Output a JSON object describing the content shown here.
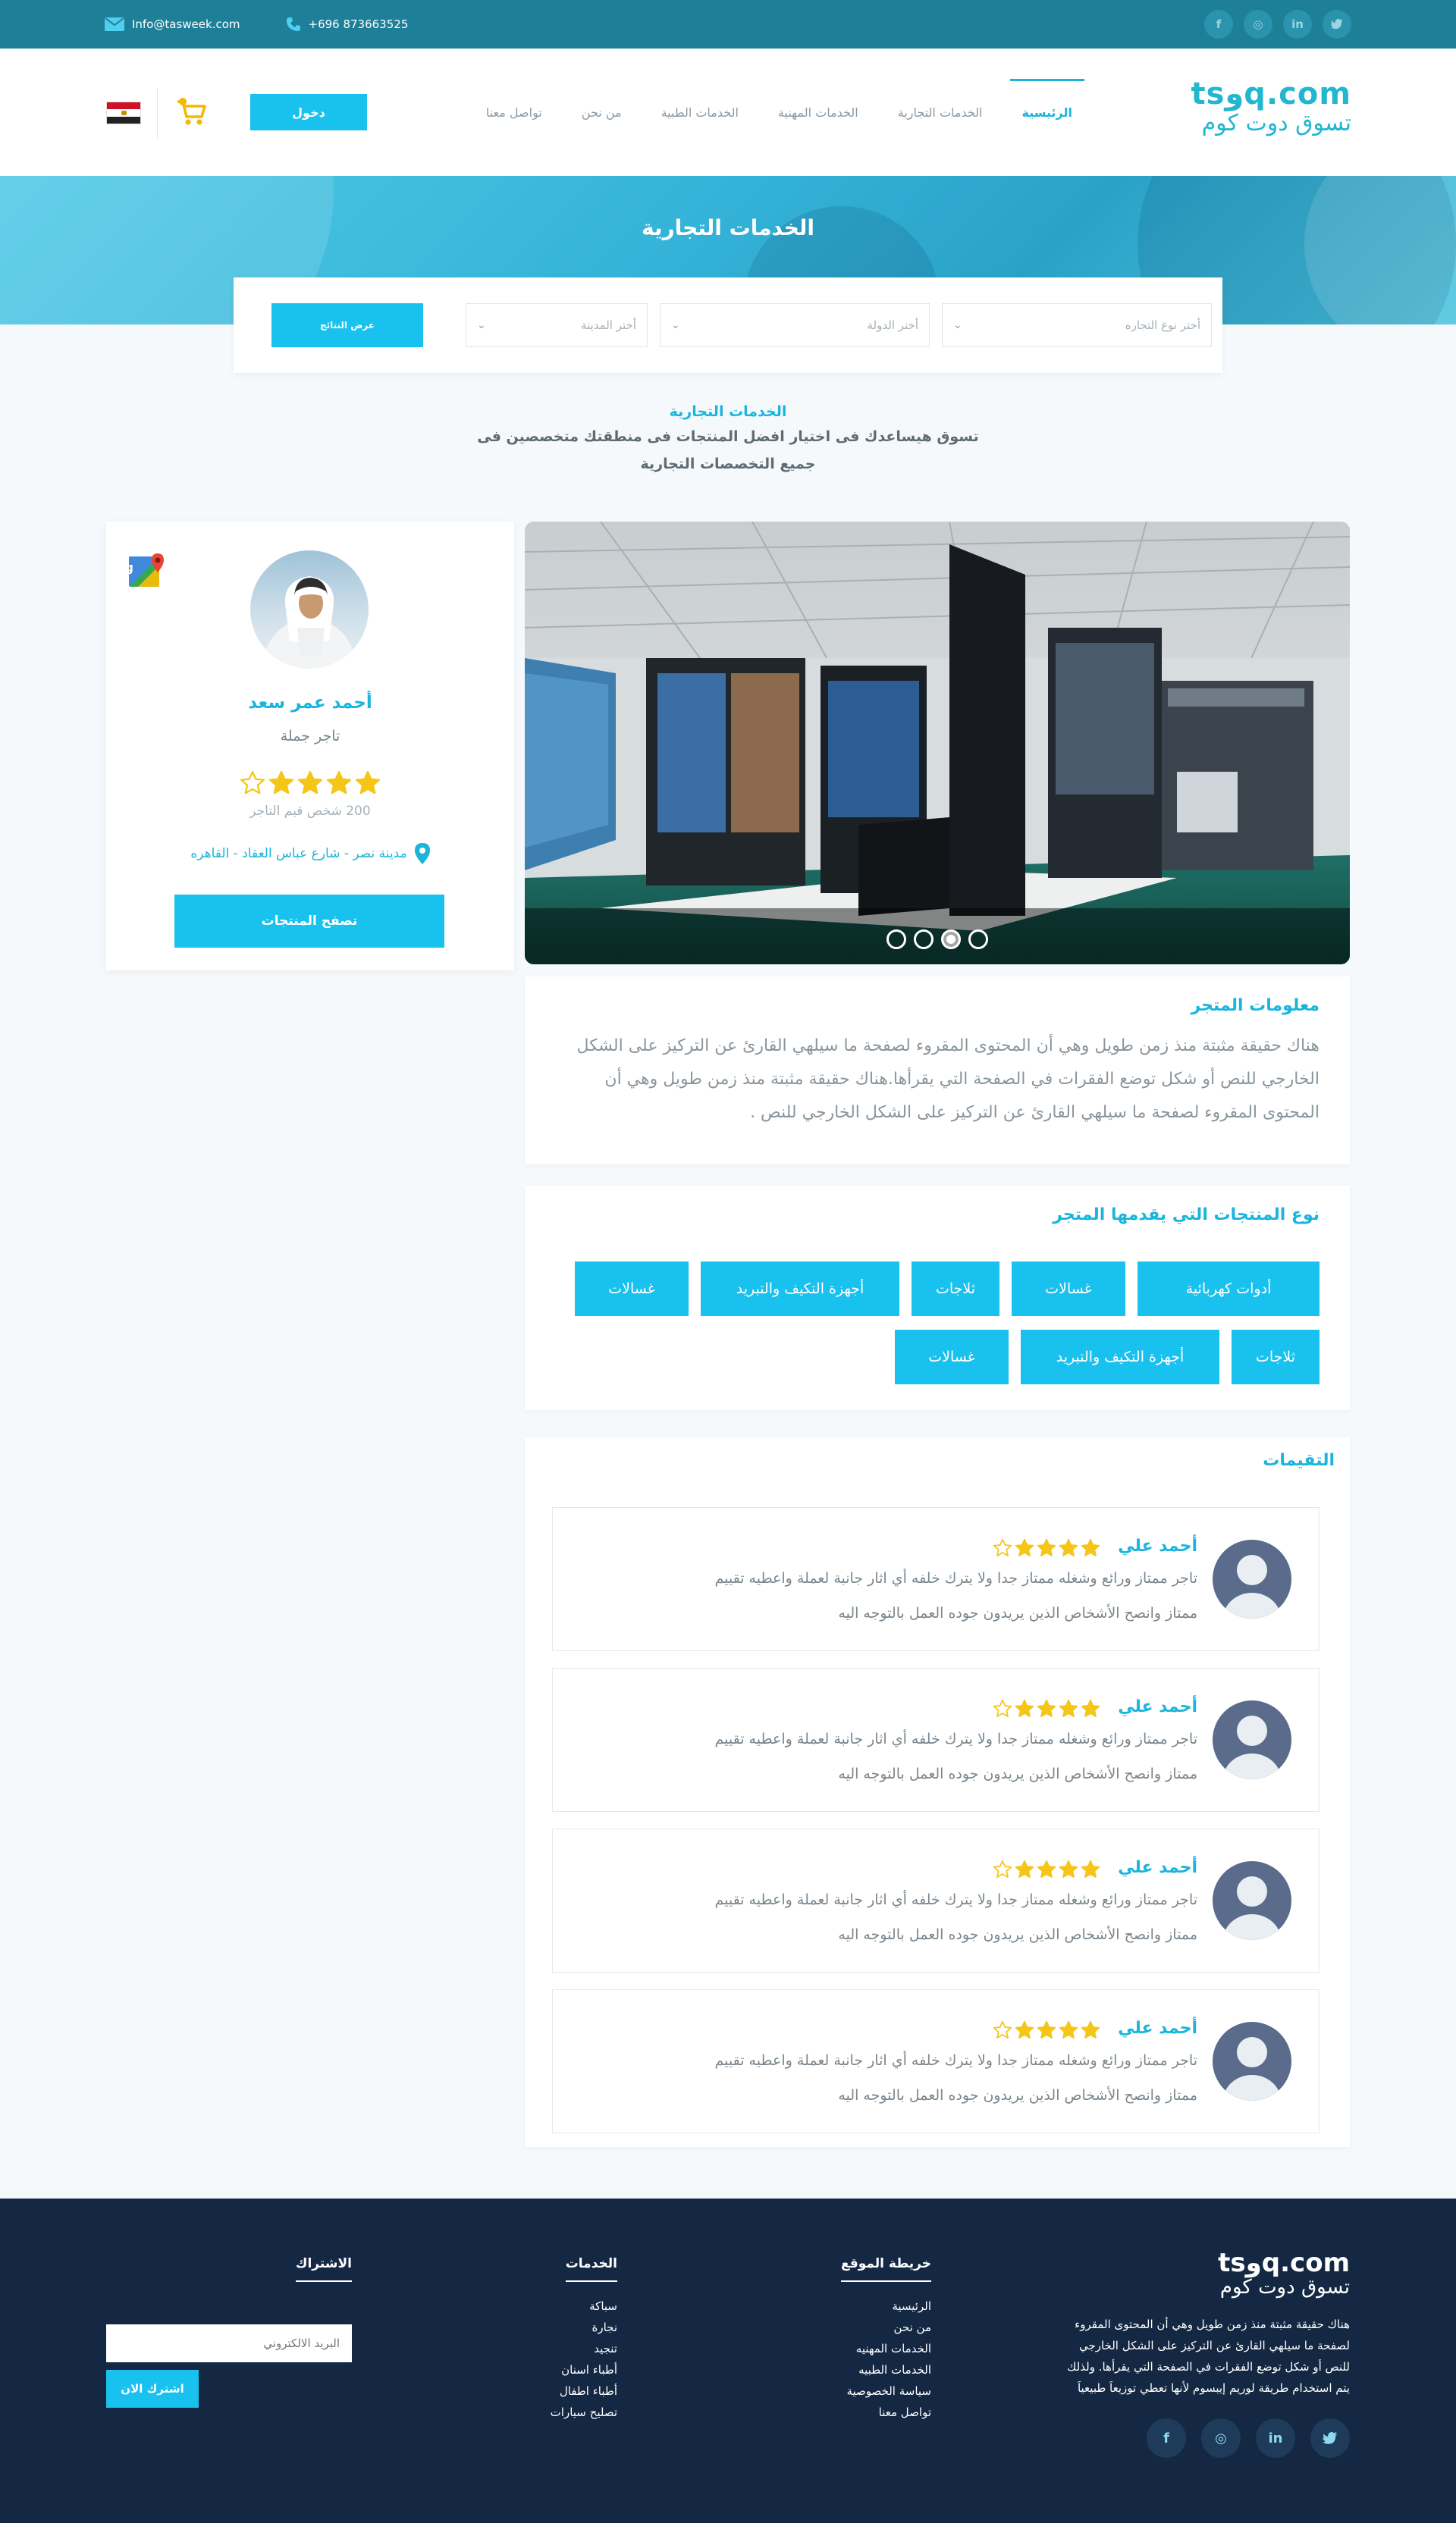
{
  "topbar": {
    "email": "Info@tasweek.com",
    "phone": "+696 873663525",
    "social": [
      "twitter-icon",
      "linkedin-icon",
      "instagram-icon",
      "facebook-icon"
    ]
  },
  "header": {
    "logo_latin": "tsوq.com",
    "logo_arabic": "تسوق دوت كوم",
    "nav": [
      "الرئيسية",
      "الخدمات التجارية",
      "الخدمات المهنية",
      "الخدمات الطبية",
      "من نحن",
      "تواصل معنا"
    ],
    "login_label": "دخول",
    "country_flag": "Egypt"
  },
  "hero": {
    "title": "الخدمات التجارية"
  },
  "search": {
    "trade_type_placeholder": "أختر نوع التجاره",
    "country_placeholder": "أختر الدولة",
    "city_placeholder": "أختر المدينة",
    "button_label": "عرض النتائج"
  },
  "intro": {
    "title": "الخدمات التجارية",
    "line1": "تسوق هيساعدك فى اختيار افضل المنتجات فى منطقتك متخصصين فى",
    "line2": "جميع التخصصات التجارية"
  },
  "profile": {
    "name": "أحمد عمر سعد",
    "role": "تاجر جملة",
    "rating": 4,
    "rating_count": "200 شخص قيم التاجر",
    "location": "مدينة نصر - شارع عباس العقاد - القاهره",
    "browse_button": "تصفح المنتجات"
  },
  "slider": {
    "slide_count": 4,
    "active_index": 1
  },
  "store_info": {
    "title": "معلومات المتجر",
    "lines": [
      "هناك حقيقة مثبتة منذ زمن طويل وهي أن المحتوى المقروء لصفحة ما سيلهي القارئ عن التركيز على الشكل",
      "الخارجي للنص أو شكل توضع الفقرات في الصفحة التي يقرأها.هناك حقيقة مثبتة منذ زمن طويل وهي أن",
      "المحتوى المقروء لصفحة ما سيلهي القارئ عن التركيز على الشكل الخارجي للنص ."
    ]
  },
  "products": {
    "title": "نوع المنتجات التي يقدمها المتجر",
    "chips": [
      "أدوات كهربائية",
      "غسالات",
      "ثلاجات",
      "أجهزة التكيف والتبريد",
      "غسالات",
      "ثلاجات",
      "أجهزة التكيف والتبريد",
      "غسالات"
    ]
  },
  "reviews": {
    "title": "التقيمات",
    "items": [
      {
        "name": "أحمد علي",
        "rating": 4,
        "text1": "تاجر ممتاز ورائع وشغله ممتاز جدا ولا يترك خلفه أي اثار جانبة لعملة واعطيه تقييم",
        "text2": "ممتاز وانصح الأشخاص الذين يريدون جوده العمل بالتوجه اليه"
      },
      {
        "name": "أحمد علي",
        "rating": 4,
        "text1": "تاجر  ممتاز ورائع وشغله ممتاز جدا ولا يترك خلفه أي اثار جانبة لعملة واعطيه تقييم",
        "text2": "ممتاز وانصح الأشخاص الذين يريدون جوده العمل بالتوجه اليه"
      },
      {
        "name": "أحمد علي",
        "rating": 4,
        "text1": "تاجر  ممتاز ورائع وشغله ممتاز جدا ولا يترك خلفه أي اثار جانبة لعملة واعطيه تقييم",
        "text2": "ممتاز وانصح الأشخاص الذين يريدون جوده العمل بالتوجه اليه"
      },
      {
        "name": "أحمد علي",
        "rating": 4,
        "text1": "تاجر ممتاز ورائع وشغله ممتاز جدا ولا يترك خلفه أي اثار جانبة لعملة واعطيه تقييم",
        "text2": "ممتاز وانصح الأشخاص الذين يريدون جوده العمل بالتوجه اليه"
      }
    ]
  },
  "footer": {
    "logo_latin": "tsوq.com",
    "logo_arabic": "تسوق دوت كوم",
    "about_lines": [
      "هناك حقيقة مثبتة منذ زمن طويل وهي أن المحتوى المقروء",
      "لصفحة ما سيلهي القارئ عن التركيز على الشكل الخارجي",
      "للنص أو شكل توضع الفقرات في الصفحة التي يقرأها. ولذلك",
      "يتم استخدام طريقة لوريم إيبسوم لأنها تعطي توزيعاَ طبيعياَ"
    ],
    "sitemap_title": "خريطة الموقع",
    "sitemap": [
      "الرئيسية",
      "من نحن",
      "الخدمات المهنيه",
      "الخدمات الطبيه",
      "سياسة الخصوصية",
      "تواصل معنا"
    ],
    "services_title": "الخدمات",
    "services": [
      "سباكة",
      "نجارة",
      "تنجيد",
      "أطباء اسنان",
      "أطباء اطفال",
      "تصليح سيارات"
    ],
    "subscribe_title": "الاشتراك",
    "email_placeholder": "البريد الالكتروني",
    "subscribe_button": "اشترك الان"
  },
  "colors": {
    "accent": "#19c1ee",
    "topbar": "#1e7f99",
    "footer": "#142843",
    "star": "#f5c518"
  }
}
